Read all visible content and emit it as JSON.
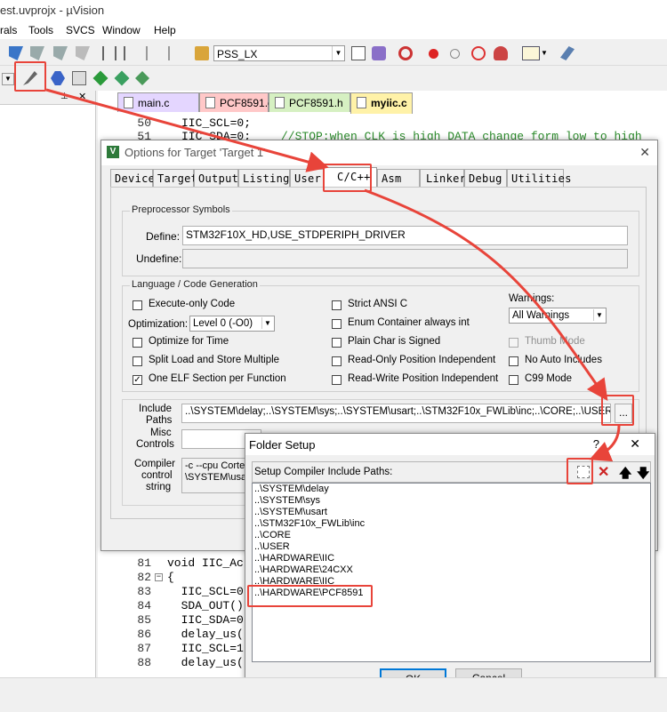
{
  "window": {
    "title": "est.uvprojx - µVision"
  },
  "menu": [
    "rals",
    "Tools",
    "SVCS",
    "Window",
    "Help"
  ],
  "toolbar": {
    "target_name": "PSS_LX"
  },
  "editor": {
    "tabs": [
      {
        "label": "main.c",
        "color": "#e4d6ff"
      },
      {
        "label": "PCF8591.c",
        "color": "#ffc8c8"
      },
      {
        "label": "PCF8591.h",
        "color": "#d6f0c2"
      },
      {
        "label": "myiic.c",
        "color": "#fff2a8"
      }
    ],
    "top_lines": [
      {
        "num": "50",
        "code": "IIC_SCL=0;",
        "comment": ""
      },
      {
        "num": "51",
        "code": "IIC_SDA=0;",
        "comment": "//STOP:when CLK is high DATA change form low to high"
      }
    ],
    "bottom_lines": [
      {
        "num": "81",
        "code": "void IIC_Ac"
      },
      {
        "num": "82",
        "code": "{"
      },
      {
        "num": "83",
        "code": "  IIC_SCL=0"
      },
      {
        "num": "84",
        "code": "  SDA_OUT()"
      },
      {
        "num": "85",
        "code": "  IIC_SDA=0"
      },
      {
        "num": "86",
        "code": "  delay_us("
      },
      {
        "num": "87",
        "code": "  IIC_SCL=1"
      },
      {
        "num": "88",
        "code": "  delay_us("
      }
    ]
  },
  "options_dialog": {
    "title": "Options for Target 'Target 1'",
    "tabs": [
      "Device",
      "Target",
      "Output",
      "Listing",
      "User",
      "C/C++",
      "Asm",
      "Linker",
      "Debug",
      "Utilities"
    ],
    "active_tab": "C/C++",
    "preprocessor": {
      "group_label": "Preprocessor Symbols",
      "define_label": "Define:",
      "define_value": "STM32F10X_HD,USE_STDPERIPH_DRIVER",
      "undefine_label": "Undefine:",
      "undefine_value": ""
    },
    "language": {
      "group_label": "Language / Code Generation",
      "execute_only": {
        "label": "Execute-only Code",
        "checked": false
      },
      "optimization_label": "Optimization:",
      "optimization_value": "Level 0 (-O0)",
      "optimize_time": {
        "label": "Optimize for Time",
        "checked": false
      },
      "split_load": {
        "label": "Split Load and Store Multiple",
        "checked": false
      },
      "one_elf": {
        "label": "One ELF Section per Function",
        "checked": true
      },
      "strict_ansi": {
        "label": "Strict ANSI C",
        "checked": false
      },
      "enum_int": {
        "label": "Enum Container always int",
        "checked": false
      },
      "plain_char": {
        "label": "Plain Char is Signed",
        "checked": false
      },
      "ro_pi": {
        "label": "Read-Only Position Independent",
        "checked": false
      },
      "rw_pi": {
        "label": "Read-Write Position Independent",
        "checked": false
      },
      "warnings_label": "Warnings:",
      "warnings_value": "All Warnings",
      "thumb_mode": {
        "label": "Thumb Mode",
        "checked": false
      },
      "no_auto_includes": {
        "label": "No Auto Includes",
        "checked": false
      },
      "c99": {
        "label": "C99 Mode",
        "checked": false
      }
    },
    "include_label_1": "Include",
    "include_label_2": "Paths",
    "include_value": "..\\SYSTEM\\delay;..\\SYSTEM\\sys;..\\SYSTEM\\usart;..\\STM32F10x_FWLib\\inc;..\\CORE;..\\USER;..\\",
    "browse_label": "...",
    "misc_label_1": "Misc",
    "misc_label_2": "Controls",
    "compiler_label_1": "Compiler",
    "compiler_label_2": "control",
    "compiler_label_3": "string",
    "compiler_value_1": "-c --cpu Cortex-",
    "compiler_value_2": "\\SYSTEM\\usa"
  },
  "folder_dialog": {
    "title": "Folder Setup",
    "help": "?",
    "close": "✕",
    "header": "Setup Compiler Include Paths:",
    "paths": [
      "..\\SYSTEM\\delay",
      "..\\SYSTEM\\sys",
      "..\\SYSTEM\\usart",
      "..\\STM32F10x_FWLib\\inc",
      "..\\CORE",
      "..\\USER",
      "..\\HARDWARE\\IIC",
      "..\\HARDWARE\\24CXX",
      "..\\HARDWARE\\IIC",
      "..\\HARDWARE\\PCF8591"
    ],
    "ok_label": "OK",
    "cancel_label": "Cancel"
  },
  "highlight_color": "#e8443a"
}
